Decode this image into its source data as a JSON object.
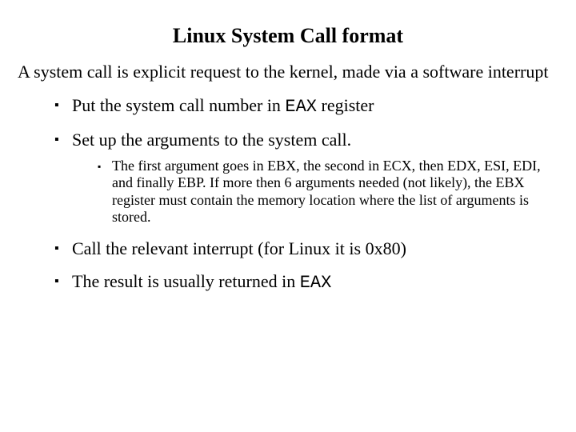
{
  "title": "Linux System Call format",
  "intro": "A system call is explicit request to the kernel, made via a software interrupt",
  "bullets": {
    "b1_pre": "Put the system call number in ",
    "b1_code": "EAX",
    "b1_post": " register",
    "b2": "Set up the arguments to the system call.",
    "b2_sub1": "The first argument goes in EBX, the second in ECX, then EDX, ESI, EDI, and finally EBP. If more then 6 arguments needed (not likely), the EBX register must contain the memory location where the list of arguments is stored.",
    "b3": "Call the relevant interrupt (for Linux it is 0x80)",
    "b4_pre": "The result is usually returned in ",
    "b4_code": "EAX"
  }
}
